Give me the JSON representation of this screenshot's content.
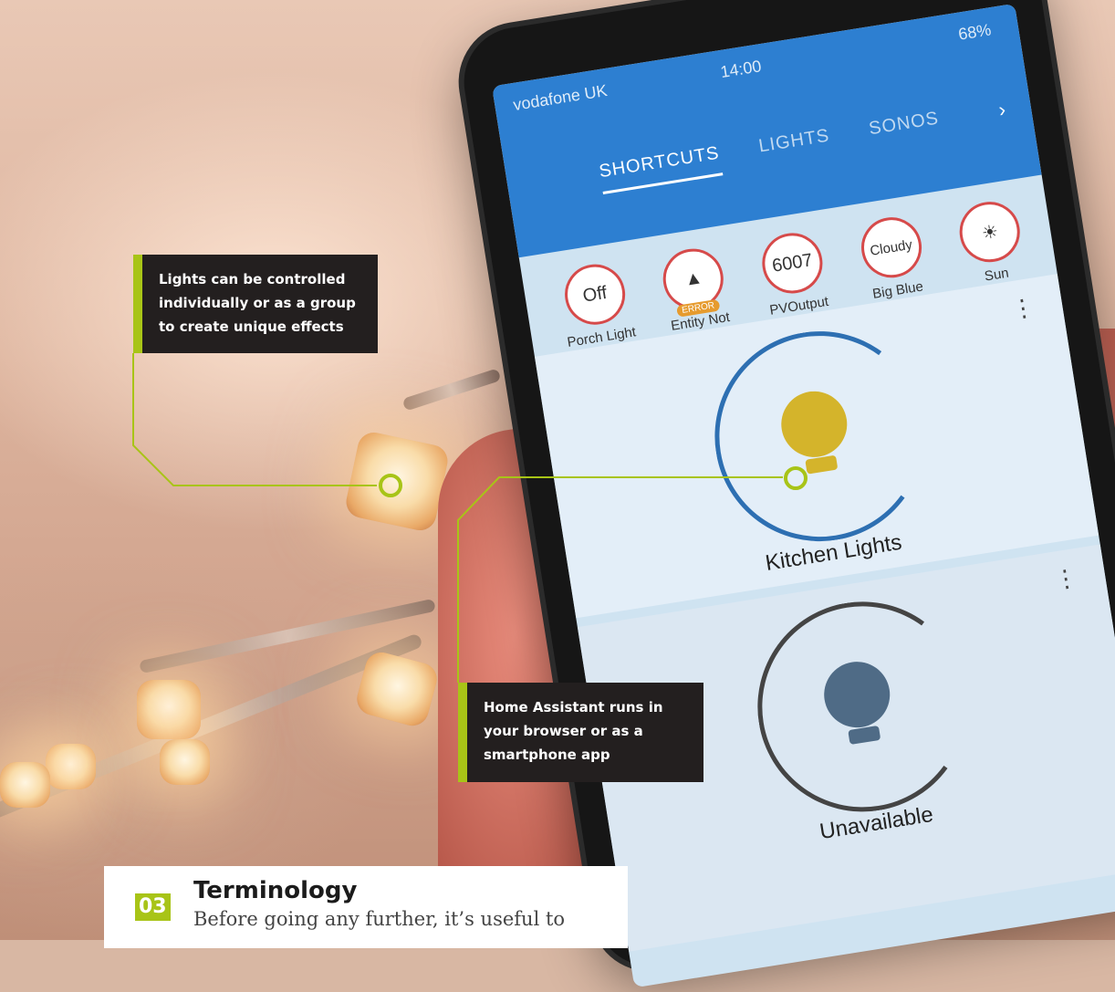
{
  "phone": {
    "status": {
      "carrier": "vodafone UK",
      "time": "14:00",
      "battery": "68%"
    },
    "tabs": [
      "SHORTCUTS",
      "LIGHTS",
      "SONOS"
    ],
    "active_tab": "SHORTCUTS",
    "badges": [
      {
        "value": "Off",
        "label": "Porch Light"
      },
      {
        "value": "",
        "tag": "ERROR",
        "label": "Entity Not Found"
      },
      {
        "value": "6007",
        "label": "PVOutput"
      },
      {
        "value": "Cloudy",
        "label": "Big Blue House"
      },
      {
        "value": "",
        "label": "Sun"
      }
    ],
    "cards": [
      {
        "label": "Kitchen Lights"
      },
      {
        "label": "Unavailable"
      }
    ]
  },
  "callouts": [
    {
      "text": "Lights can be controlled individually or as a group to create unique effects"
    },
    {
      "text": "Home Assistant runs in your browser or as a smartphone app"
    }
  ],
  "section": {
    "number": "03",
    "title": "Terminology",
    "text": "Before going any further, it’s useful to"
  },
  "colors": {
    "accent": "#a8c417",
    "callout_bg": "#231f1f",
    "app_blue": "#2d7fd1"
  }
}
